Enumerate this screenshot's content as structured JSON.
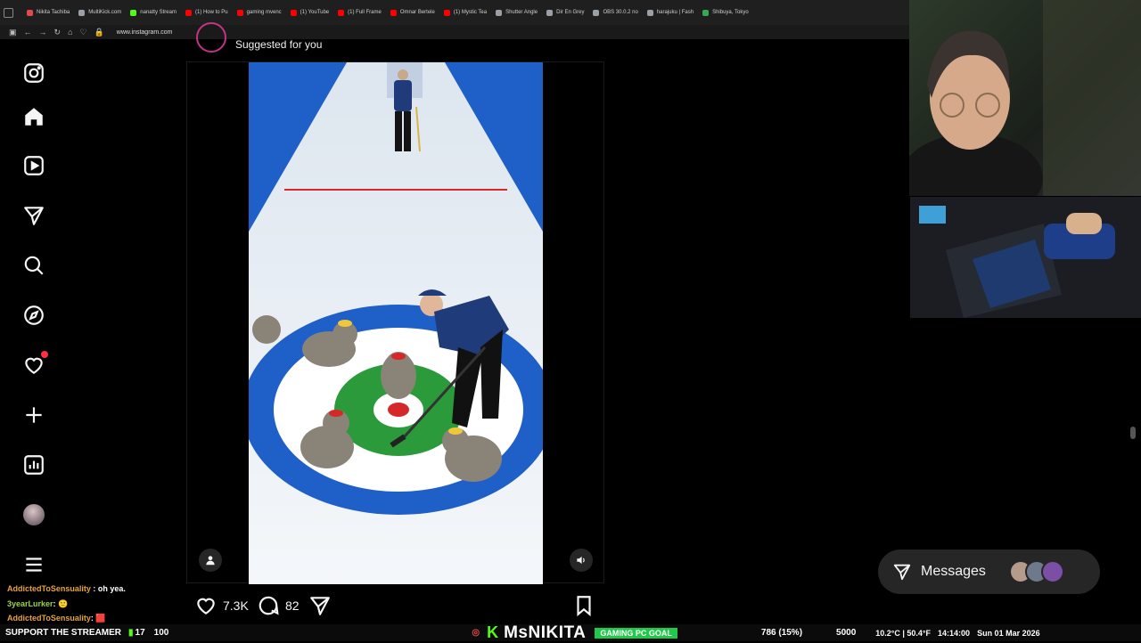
{
  "browser": {
    "bookmarks": [
      {
        "label": "Nikita Tachiba",
        "color": "#e2494b"
      },
      {
        "label": "MultiKick.com",
        "color": "#9aa0a6"
      },
      {
        "label": "nanatty Stream",
        "color": "#53fc18"
      },
      {
        "label": "(1) How to Pu",
        "color": "#ff0000"
      },
      {
        "label": "gaming mvenc",
        "color": "#ff0000"
      },
      {
        "label": "(1) YouTube",
        "color": "#ff0000"
      },
      {
        "label": "(1) Full Frame",
        "color": "#ff0000"
      },
      {
        "label": "Omnar Bertele",
        "color": "#ff0000"
      },
      {
        "label": "(1) Mystic Tea",
        "color": "#ff0000"
      },
      {
        "label": "Shutter Angle",
        "color": "#9aa0a6"
      },
      {
        "label": "Dir En Grey",
        "color": "#9aa0a6"
      },
      {
        "label": "OBS 30.0.2 no",
        "color": "#9aa0a6"
      },
      {
        "label": "harajuku | Fash",
        "color": "#9aa0a6"
      },
      {
        "label": "Shibuya, Tokyo",
        "color": "#34a853"
      }
    ],
    "url": "www.instagram.com"
  },
  "feed": {
    "suggested_label": "Suggested for you",
    "likes": "7.3K",
    "comments": "82"
  },
  "messages": {
    "label": "Messages"
  },
  "chat": [
    {
      "user": "AddictedToSensuality",
      "text": ": oh yea."
    },
    {
      "user": "3yearLurker",
      "text": ":"
    },
    {
      "user": "AddictedToSensuality",
      "text": ":"
    }
  ],
  "ticker": {
    "support": "SUPPORT THE STREAMER",
    "count_a": "17",
    "count_b": "100",
    "brand": "MsNIKITA",
    "goal_label": "GAMING PC GOAL",
    "goal_progress": "786 (15%)",
    "goal_target": "5000",
    "weather": "10.2°C | 50.4°F",
    "time": "14:14:00",
    "date": "Sun 01 Mar 2026"
  },
  "colors": {
    "accent": "#53fc18",
    "notification": "#ff3040",
    "rink_blue": "#1e5fc8",
    "rink_green": "#2a9a3a",
    "rink_red": "#d62828"
  }
}
